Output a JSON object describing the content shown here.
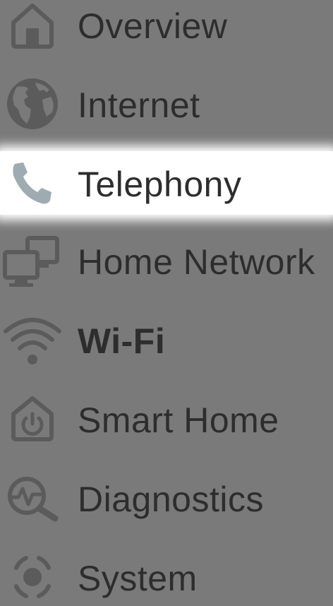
{
  "menu": {
    "items": [
      {
        "label": "Overview",
        "icon": "home-icon",
        "highlighted": false,
        "bold": false
      },
      {
        "label": "Internet",
        "icon": "globe-icon",
        "highlighted": false,
        "bold": false
      },
      {
        "label": "Telephony",
        "icon": "phone-icon",
        "highlighted": true,
        "bold": false
      },
      {
        "label": "Home Network",
        "icon": "home-network-icon",
        "highlighted": false,
        "bold": false
      },
      {
        "label": "Wi-Fi",
        "icon": "wifi-icon",
        "highlighted": false,
        "bold": true
      },
      {
        "label": "Smart Home",
        "icon": "smart-home-icon",
        "highlighted": false,
        "bold": false
      },
      {
        "label": "Diagnostics",
        "icon": "diagnostics-icon",
        "highlighted": false,
        "bold": false
      },
      {
        "label": "System",
        "icon": "system-icon",
        "highlighted": false,
        "bold": false
      }
    ]
  },
  "colors": {
    "overlay": "#7a7a7a",
    "highlight": "#ffffff",
    "text": "#2d2d2d",
    "icon_dim": "#5b5b5b",
    "icon_highlight": "#9eacb2"
  }
}
